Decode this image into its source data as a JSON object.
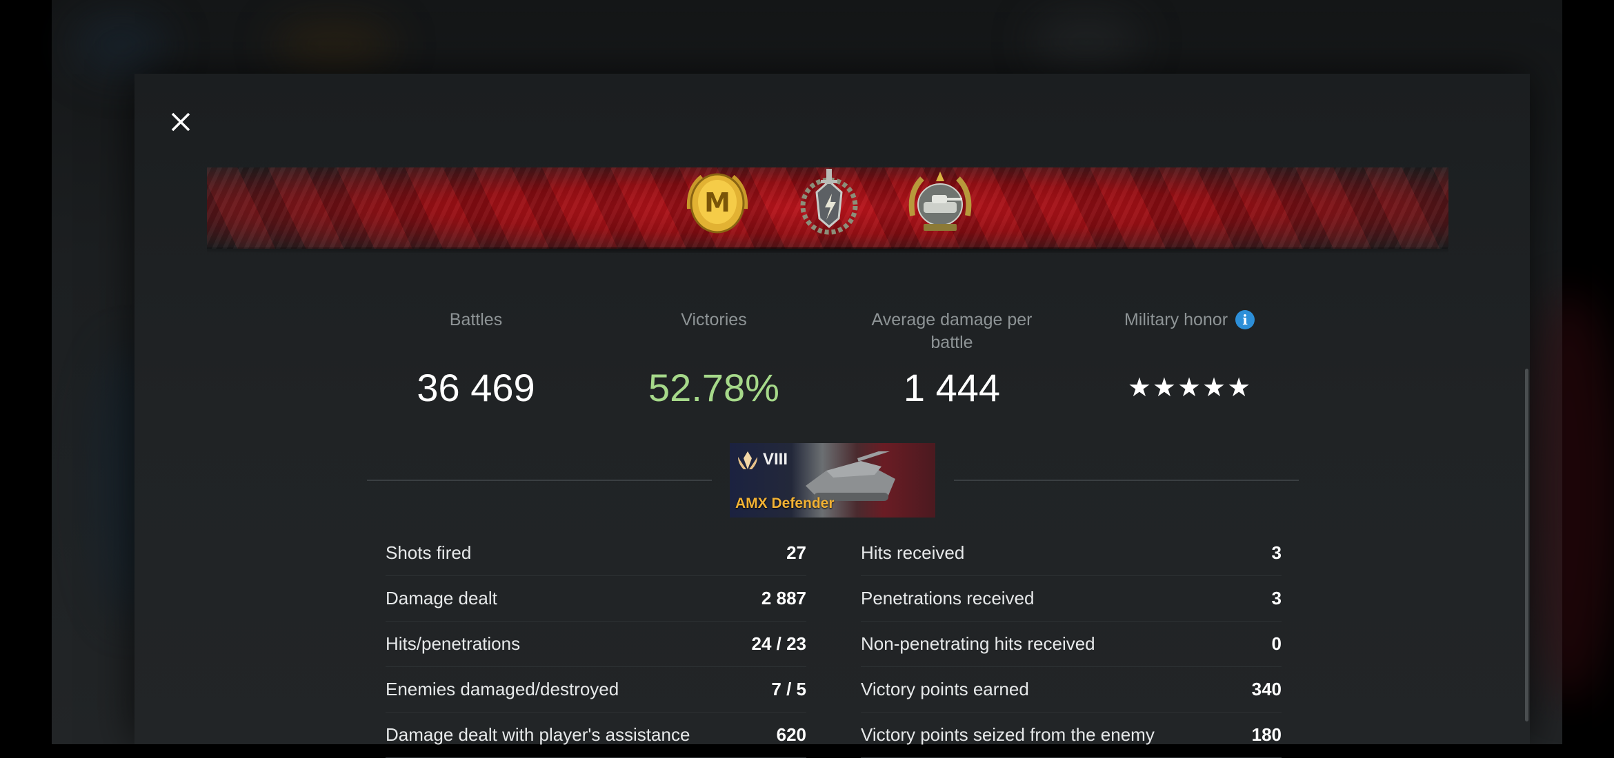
{
  "stats": {
    "battles_label": "Battles",
    "battles_value": "36 469",
    "victories_label": "Victories",
    "victories_value": "52.78%",
    "avg_damage_label_line1": "Average damage per",
    "avg_damage_label_line2": "battle",
    "avg_damage_value": "1 444",
    "military_honor_label": "Military honor",
    "military_honor_stars": "★★★★★",
    "info_icon_glyph": "i"
  },
  "vehicle": {
    "tier": "VIII",
    "name": "AMX Defender"
  },
  "left_stats": [
    {
      "label": "Shots fired",
      "value": "27"
    },
    {
      "label": "Damage dealt",
      "value": "2 887"
    },
    {
      "label": "Hits/penetrations",
      "value": "24 / 23"
    },
    {
      "label": "Enemies damaged/destroyed",
      "value": "7 / 5"
    },
    {
      "label": "Damage dealt with player's assistance",
      "value": "620"
    }
  ],
  "right_stats": [
    {
      "label": "Hits received",
      "value": "3"
    },
    {
      "label": "Penetrations received",
      "value": "3"
    },
    {
      "label": "Non-penetrating hits received",
      "value": "0"
    },
    {
      "label": "Victory points earned",
      "value": "340"
    },
    {
      "label": "Victory points seized from the enemy",
      "value": "180"
    }
  ],
  "icons": {
    "close": "close-icon",
    "medal_1": "mastery-m-medal-icon",
    "medal_2": "sword-emblem-medal-icon",
    "medal_3": "tank-wreath-medal-icon",
    "tier_emblem": "tier-emblem-icon",
    "vehicle": "tank-image"
  },
  "colors": {
    "victories_green": "#a6d98a",
    "vehicle_name_gold": "#f2b234",
    "info_blue": "#2d8fd8",
    "ribbon_red": "#b3121a"
  }
}
